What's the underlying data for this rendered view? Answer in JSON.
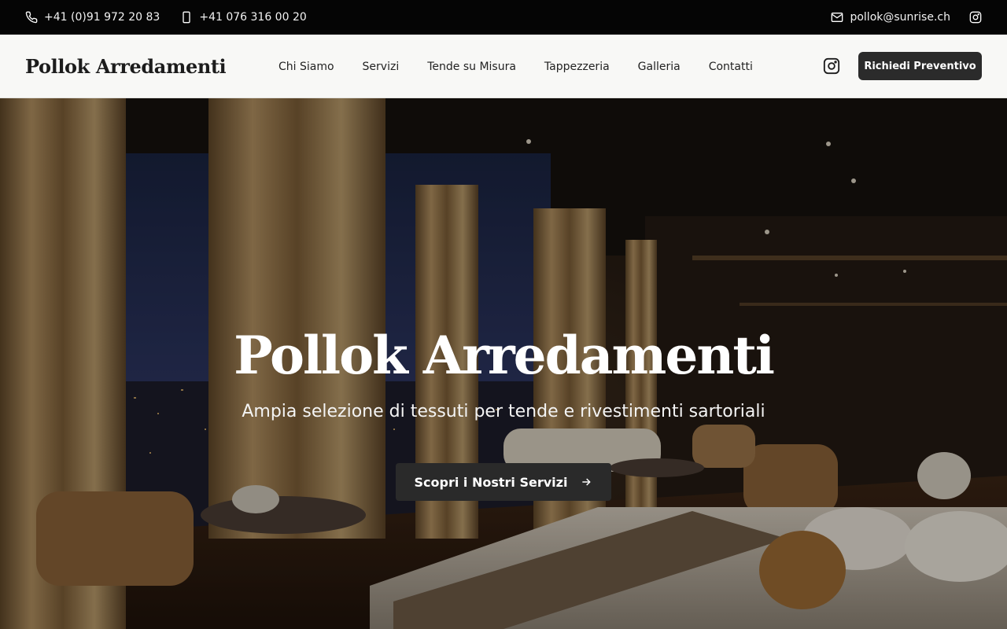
{
  "topbar": {
    "phone": "+41 (0)91 972 20 83",
    "mobile": "+41 076 316 00 20",
    "email": "pollok@sunrise.ch",
    "icons": [
      "phone-icon",
      "mobile-icon",
      "mail-icon",
      "instagram-icon"
    ]
  },
  "nav": {
    "brand": "Pollok Arredamenti",
    "items": [
      "Chi Siamo",
      "Servizi",
      "Tende su Misura",
      "Tappezzeria",
      "Galleria",
      "Contatti"
    ],
    "cta": "Richiedi Preventivo"
  },
  "hero": {
    "title": "Pollok Arredamenti",
    "subtitle": "Ampia selezione di tessuti per tende e rivestimenti sartoriali",
    "cta": "Scopri i Nostri Servizi"
  },
  "colors": {
    "topbar_bg": "#050505",
    "nav_bg": "#f8f8f6",
    "button_dark": "#2b2b2b",
    "curtain": "#a8875a"
  }
}
